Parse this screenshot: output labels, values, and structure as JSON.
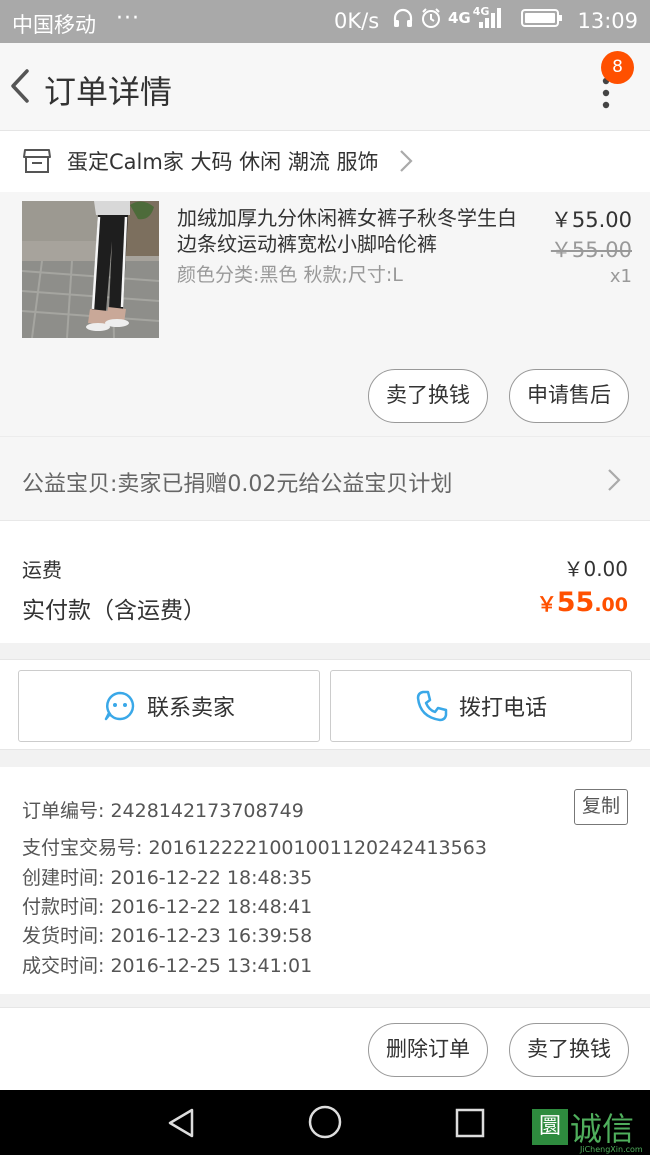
{
  "status_bar": {
    "carrier": "中国移动",
    "overflow": "···",
    "speed": "0K/s",
    "network": "4G",
    "network2": "4G",
    "time": "13:09"
  },
  "header": {
    "title": "订单详情",
    "badge": "8"
  },
  "shop": {
    "name": "蛋定Calm家 大码 休闲 潮流 服饰"
  },
  "item": {
    "title": "加绒加厚九分休闲裤女裤子秋冬学生白边条纹运动裤宽松小脚哈伦裤",
    "spec": "颜色分类:黑色  秋款;尺寸:L",
    "price": "￥55.00",
    "original_price": "￥55.00",
    "quantity": "x1",
    "buttons": {
      "sell": "卖了换钱",
      "after_sale": "申请售后"
    }
  },
  "charity": {
    "text": "公益宝贝:卖家已捐赠0.02元给公益宝贝计划"
  },
  "fees": {
    "shipping_label": "运费",
    "shipping_value": "￥0.00",
    "paid_label": "实付款（含运费）",
    "paid_currency": "￥",
    "paid_integer": "55",
    "paid_decimal": ".00"
  },
  "contact": {
    "seller": "联系卖家",
    "phone": "拨打电话"
  },
  "order_info": {
    "order_no": "订单编号: 2428142173708749",
    "copy": "复制",
    "alipay_no": "支付宝交易号: 2016122221001001120242413563",
    "created": "创建时间: 2016-12-22 18:48:35",
    "paid": "付款时间: 2016-12-22 18:48:41",
    "shipped": "发货时间: 2016-12-23 16:39:58",
    "completed": "成交时间: 2016-12-25 13:41:01"
  },
  "bottom_actions": {
    "delete": "删除订单",
    "sell": "卖了换钱"
  },
  "watermark": {
    "logo": "圜",
    "text": "诚信",
    "url": "JiChengXin.com"
  },
  "colors": {
    "accent": "#ff5000",
    "status_bar": "#a9a9a9",
    "contact_icon": "#3aa8e8"
  }
}
